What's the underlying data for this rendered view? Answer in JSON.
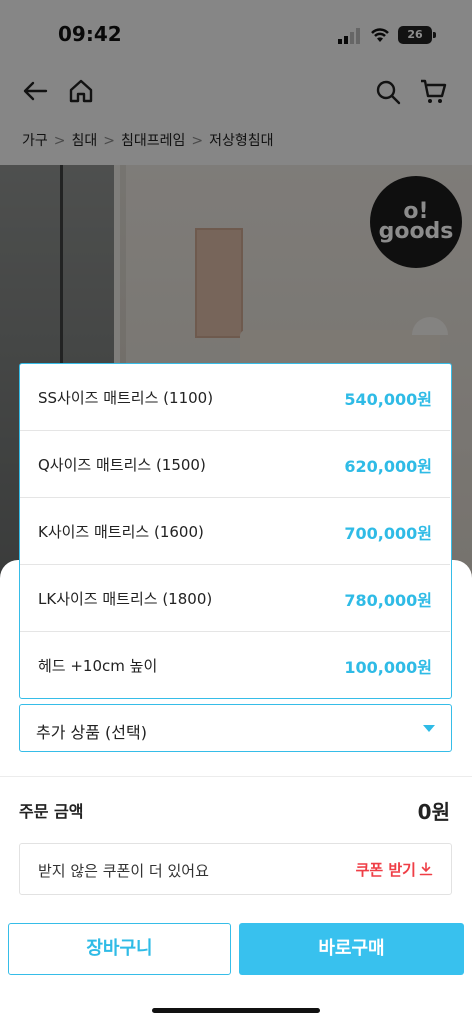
{
  "status_bar": {
    "time": "09:42",
    "battery": "26"
  },
  "breadcrumb": [
    "가구",
    "침대",
    "침대프레임",
    "저상형침대"
  ],
  "product_image": {
    "logo_text_1": "o!",
    "logo_text_2": "goods"
  },
  "options": [
    {
      "label": "SS사이즈 매트리스 (1100)",
      "price": "540,000원"
    },
    {
      "label": "Q사이즈 매트리스 (1500)",
      "price": "620,000원"
    },
    {
      "label": "K사이즈 매트리스 (1600)",
      "price": "700,000원"
    },
    {
      "label": "LK사이즈 매트리스 (1800)",
      "price": "780,000원"
    },
    {
      "label": "헤드 +10cm 높이",
      "price": "100,000원"
    }
  ],
  "extra_select": {
    "label": "추가 상품 (선택)"
  },
  "order": {
    "total_label": "주문 금액",
    "total_value": "0원"
  },
  "coupon": {
    "text": "받지 않은 쿠폰이 더 있어요",
    "button": "쿠폰 받기"
  },
  "actions": {
    "cart": "장바구니",
    "buy": "바로구매"
  },
  "colors": {
    "accent": "#36bde8",
    "coupon": "#ef3e46"
  }
}
